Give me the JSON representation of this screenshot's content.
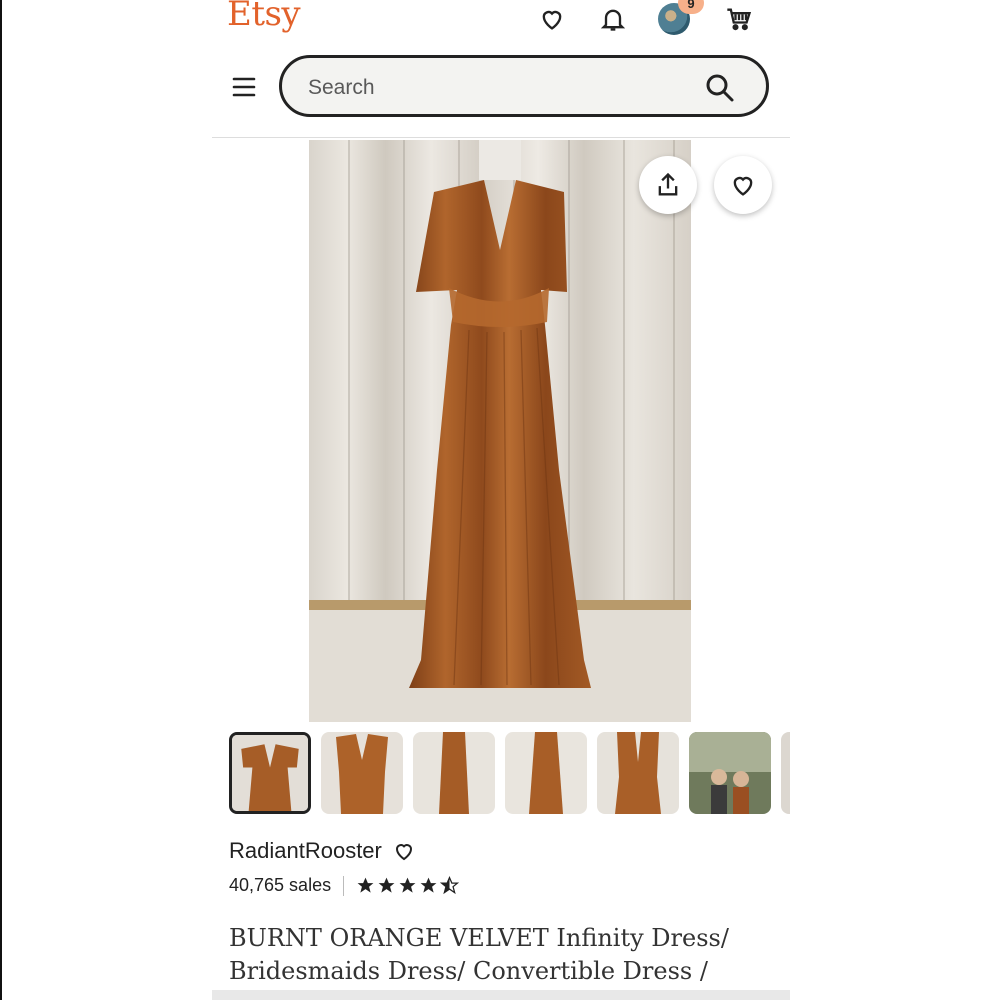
{
  "header": {
    "logo": "Etsy",
    "cart_badge": "9",
    "icons": [
      "heart-icon",
      "bell-icon",
      "avatar",
      "cart-icon",
      "menu-icon"
    ]
  },
  "search": {
    "placeholder": "Search"
  },
  "listing": {
    "image_actions": [
      "share-icon",
      "favorite-heart-icon"
    ],
    "thumbnails_count_visible": 7,
    "selected_thumbnail": 1,
    "shop_name": "RadiantRooster",
    "sales": "40,765 sales",
    "rating": 4.5,
    "title": "BURNT ORANGE VELVET Infinity Dress/ Bridesmaids Dress/ Convertible Dress /"
  },
  "colors": {
    "brand": "#e2622b",
    "dress": "#a85a25",
    "text": "#222222"
  }
}
